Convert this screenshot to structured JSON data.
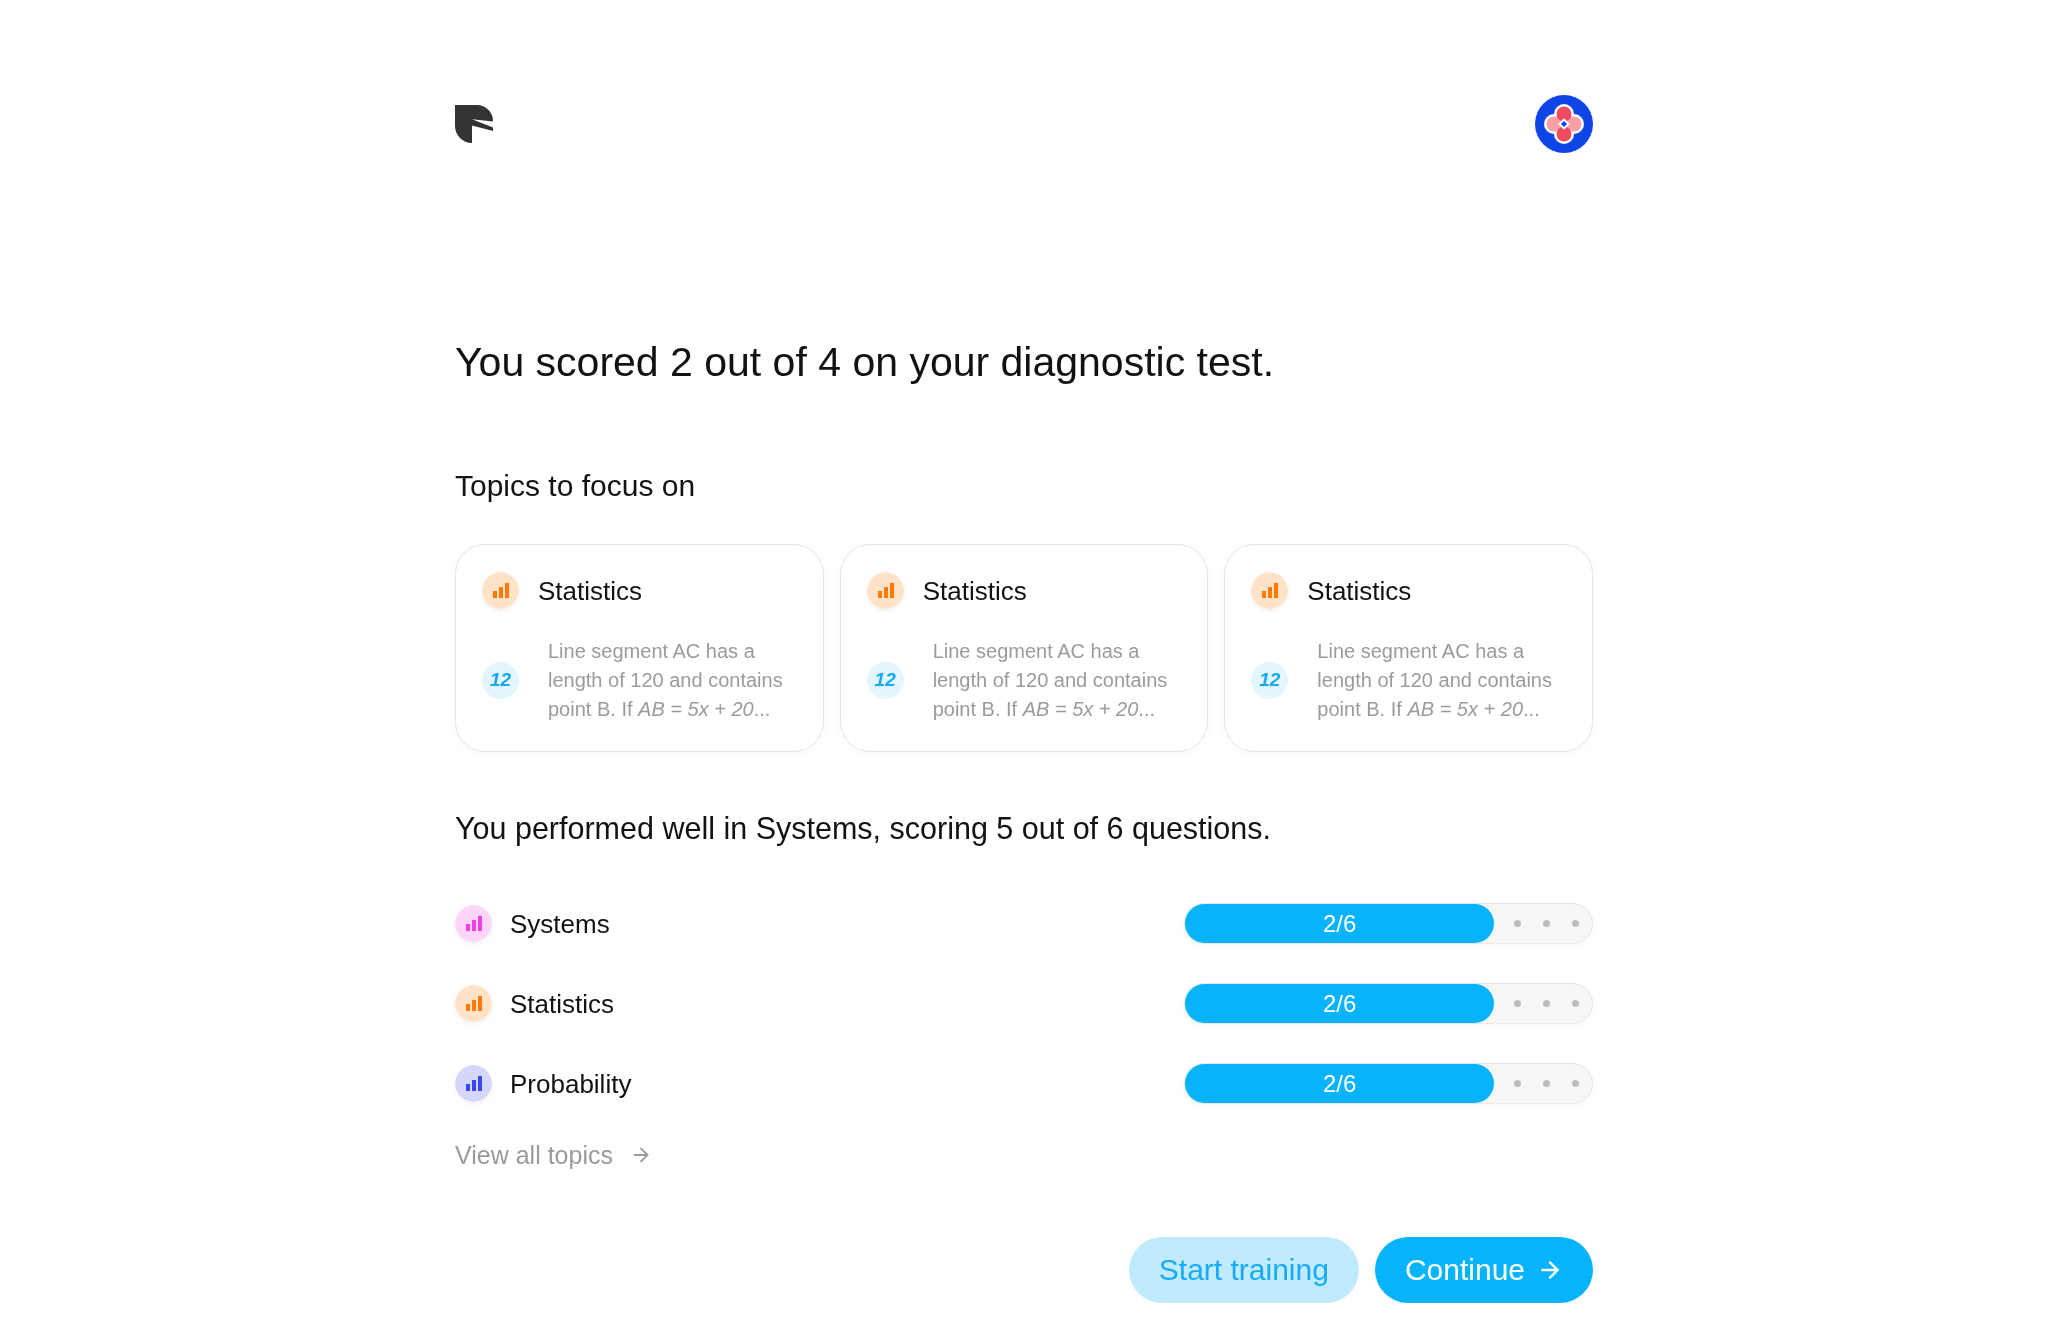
{
  "headline": "You scored 2 out of 4 on your diagnostic test.",
  "focus": {
    "title": "Topics to focus on",
    "cards": [
      {
        "topic": "Statistics",
        "color": "#ff7a00",
        "question_number": "12",
        "question": "Line segment AC has a length of 120 and contains point B. If *AB = 5x + 20*..."
      },
      {
        "topic": "Statistics",
        "color": "#ff7a00",
        "question_number": "12",
        "question": "Line segment AC has a length of 120 and contains point B. If *AB = 5x + 20*..."
      },
      {
        "topic": "Statistics",
        "color": "#ff7a00",
        "question_number": "12",
        "question": "Line segment AC has a length of 120 and contains point B. If *AB = 5x + 20*..."
      }
    ]
  },
  "performance": {
    "summary": "You performed well in Systems, scoring 5 out of 6 questions.",
    "rows": [
      {
        "topic": "Systems",
        "color": "#f23fe4",
        "level": 0.76,
        "reading": "2/6"
      },
      {
        "topic": "Statistics",
        "color": "#ff7a00",
        "level": 0.76,
        "reading": "2/6"
      },
      {
        "topic": "Probability",
        "color": "#3a46f2",
        "level": 0.76,
        "reading": "2/6"
      }
    ],
    "link": "View all topics"
  },
  "buttons": [
    {
      "label": "Start training",
      "kind": "secondary"
    },
    {
      "label": "Continue",
      "kind": "primary"
    }
  ]
}
